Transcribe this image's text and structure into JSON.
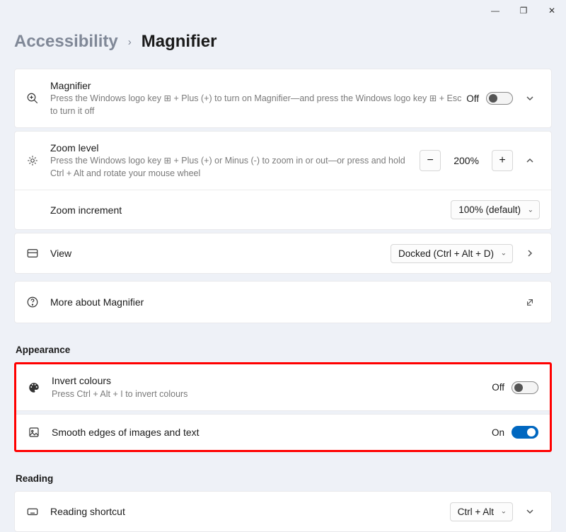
{
  "window": {
    "minimize": "—",
    "restore": "❐",
    "close": "✕"
  },
  "breadcrumb": {
    "parent": "Accessibility",
    "sep": "›",
    "current": "Magnifier"
  },
  "magnifier": {
    "title": "Magnifier",
    "desc_a": "Press the Windows logo key ",
    "desc_b": " + Plus (+) to turn on Magnifier—and press the Windows logo key ",
    "desc_c": " + Esc to turn it off",
    "state": "Off"
  },
  "zoom": {
    "title": "Zoom level",
    "desc_a": "Press the Windows logo key ",
    "desc_b": " + Plus (+) or Minus (-) to zoom in or out—or press and hold Ctrl + Alt and rotate your mouse wheel",
    "minus": "−",
    "plus": "+",
    "value": "200%"
  },
  "increment": {
    "title": "Zoom increment",
    "value": "100% (default)"
  },
  "view": {
    "title": "View",
    "value": "Docked (Ctrl + Alt + D)"
  },
  "more": {
    "title": "More about Magnifier"
  },
  "appearance_header": "Appearance",
  "invert": {
    "title": "Invert colours",
    "desc": "Press Ctrl + Alt + I to invert colours",
    "state": "Off"
  },
  "smooth": {
    "title": "Smooth edges of images and text",
    "state": "On"
  },
  "reading_header": "Reading",
  "reading_shortcut": {
    "value": "Ctrl + Alt"
  }
}
